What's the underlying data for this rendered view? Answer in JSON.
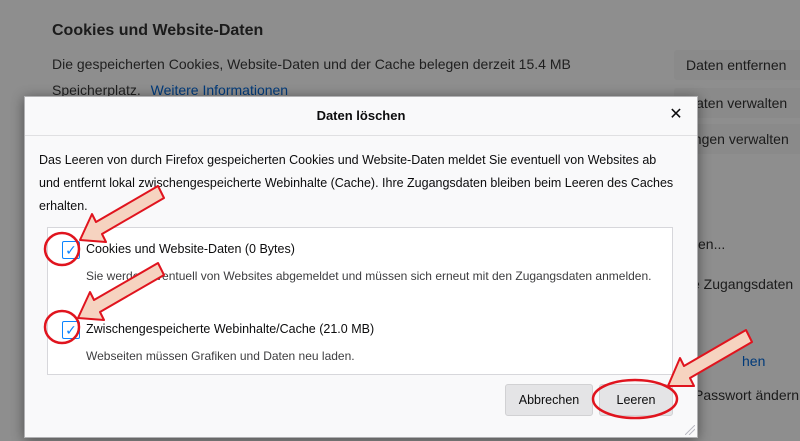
{
  "background": {
    "heading": "Cookies und Website-Daten",
    "description": "Die gespeicherten Cookies, Website-Daten und der Cache belegen derzeit 15.4 MB Speicherplatz.",
    "more_info_link": "Weitere Informationen",
    "buttons": [
      "Daten entfernen",
      "Daten verwalten",
      "ungen verwalten"
    ],
    "side_texts": [
      "en...",
      "e Zugangsdaten",
      "hen",
      "Passwort ändern"
    ]
  },
  "dialog": {
    "title": "Daten löschen",
    "close_glyph": "✕",
    "body_text": "Das Leeren von durch Firefox gespeicherten Cookies und Website-Daten meldet Sie eventuell von Websites ab und entfernt lokal zwischengespeicherte Webinhalte (Cache). Ihre Zugangsdaten bleiben beim Leeren des Caches erhalten.",
    "options": [
      {
        "label": "Cookies und Website-Daten (0 Bytes)",
        "description": "Sie werden eventuell von Websites abgemeldet und müssen sich erneut mit den Zugangsdaten anmelden.",
        "checked": true,
        "check_glyph": "✓"
      },
      {
        "label": "Zwischengespeicherte Webinhalte/Cache (21.0 MB)",
        "description": "Webseiten müssen Grafiken und Daten neu laden.",
        "checked": true,
        "check_glyph": "✓"
      }
    ],
    "cancel_label": "Abbrechen",
    "clear_label": "Leeren"
  },
  "colors": {
    "annotation_red": "#e0141e",
    "annotation_fill": "#f6d3c0",
    "checkbox_blue": "#0a84ff"
  }
}
